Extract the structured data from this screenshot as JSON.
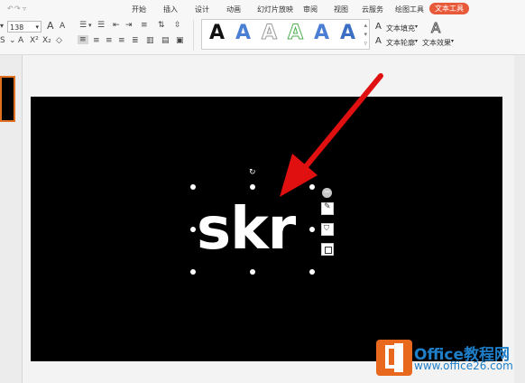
{
  "ribbon": {
    "tabs": [
      {
        "label": "开始"
      },
      {
        "label": "插入"
      },
      {
        "label": "设计"
      },
      {
        "label": "动画"
      },
      {
        "label": "幻灯片放映"
      },
      {
        "label": "审阅"
      },
      {
        "label": "视图"
      },
      {
        "label": "云服务"
      },
      {
        "label": "绘图工具"
      },
      {
        "label": "文本工具"
      }
    ],
    "font_size": "138",
    "grow_font": "A",
    "shrink_font": "A",
    "wordart_styles": [
      {
        "letter": "A",
        "color": "#111111"
      },
      {
        "letter": "A",
        "color": "#4a7fd4"
      },
      {
        "letter": "A",
        "color": "#c8c8c8"
      },
      {
        "letter": "A",
        "color": "#d8f0d8"
      },
      {
        "letter": "A",
        "color": "#4a7fd4"
      },
      {
        "letter": "A",
        "color": "#3a6fc4"
      }
    ],
    "text_fill": "文本填充",
    "text_outline": "文本轮廓",
    "text_effects": "文本效果",
    "effects_glyph": "A"
  },
  "slide": {
    "text": "skr",
    "background": "#000000"
  },
  "watermark": {
    "brand": "Office教程网",
    "url": "www.office26.com"
  }
}
